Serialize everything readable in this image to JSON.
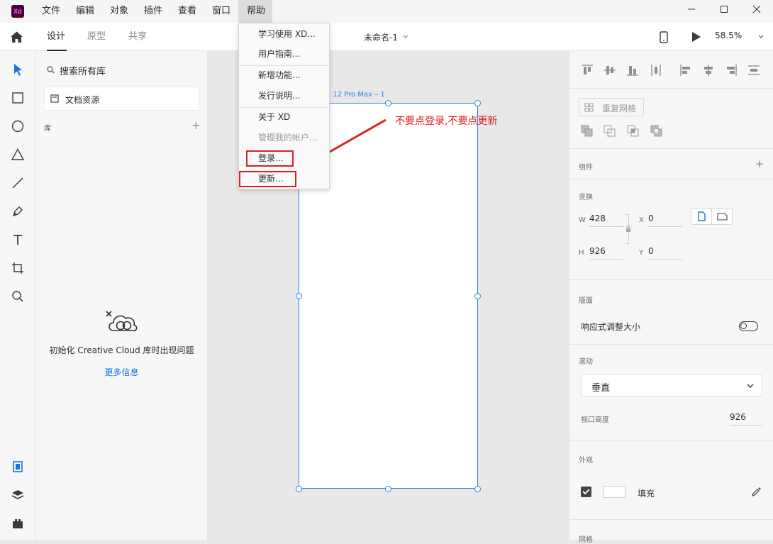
{
  "menubar": {
    "app_icon": "Xd",
    "items": [
      "文件",
      "编辑",
      "对象",
      "插件",
      "查看",
      "窗口",
      "帮助"
    ],
    "active": "帮助"
  },
  "toolbar": {
    "tabs": [
      "设计",
      "原型",
      "共享"
    ],
    "active_tab": "设计",
    "doc_title": "未命名-1",
    "zoom": "58.5%"
  },
  "library": {
    "search_placeholder": "搜索所有库",
    "doc_assets": "文档资源",
    "section_label": "库",
    "error_text": "初始化 Creative Cloud 库时出现问题",
    "more_info": "更多信息"
  },
  "help_menu": {
    "items": [
      {
        "label": "学习使用 XD..."
      },
      {
        "label": "用户指南..."
      },
      {
        "label": "新增功能..."
      },
      {
        "label": "发行说明..."
      },
      {
        "label": "关于 XD"
      },
      {
        "label": "管理我的帐户..."
      },
      {
        "label": "登录..."
      },
      {
        "label": "更新..."
      }
    ]
  },
  "canvas": {
    "artboard_label": "3、12 Pro Max – 1",
    "annotation": "不要点登录,不要点更新"
  },
  "props": {
    "repeat_grid": "重复网格",
    "components": "组件",
    "transform": "变换",
    "w_label": "W",
    "w_value": "428",
    "x_label": "X",
    "x_value": "0",
    "h_label": "H",
    "h_value": "926",
    "y_label": "Y",
    "y_value": "0",
    "artboard_section": "版面",
    "responsive": "响应式调整大小",
    "scroll_section": "滚动",
    "scroll_value": "垂直",
    "viewport_label": "视口高度",
    "viewport_value": "926",
    "appearance": "外观",
    "fill_label": "填充",
    "grid_section": "网格"
  },
  "colors": {
    "accent": "#2680eb",
    "annotation_red": "#e02020",
    "xd_bg": "#470137",
    "xd_fg": "#ff61f6"
  }
}
